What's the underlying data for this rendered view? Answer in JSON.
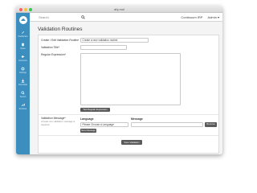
{
  "window": {
    "url_title": "ahj.mol"
  },
  "sidebar": {
    "items": [
      {
        "label": "Dashboard",
        "icon": "pencil-icon"
      },
      {
        "label": "Notes",
        "icon": "document-icon"
      },
      {
        "label": "Announce",
        "icon": "megaphone-icon"
      },
      {
        "label": "Settings",
        "icon": "gear-icon"
      },
      {
        "label": "Download",
        "icon": "download-icon"
      },
      {
        "label": "Search",
        "icon": "search-icon"
      },
      {
        "label": "Routines",
        "icon": "wrench-icon"
      }
    ]
  },
  "topbar": {
    "search_placeholder": "Search",
    "user_links": [
      "Continuum IRP",
      "Admin ▾"
    ]
  },
  "page": {
    "title": "Validation Routines"
  },
  "form": {
    "routine_label": "Create / Edit Validation Routine",
    "routine_select": "Create a new validation routine",
    "title_label": "Validation Title*",
    "title_value": "",
    "regex_label": "Regular Expression*",
    "regex_value": "",
    "test_button": "Test Regular Expression",
    "messages_label": "Validation Message*",
    "messages_hint": "At least one validation message is required.",
    "language_header": "Language",
    "message_header": "Message",
    "language_select": "Please Choose a Language",
    "message_value": "",
    "remove_button": "Remove",
    "new_message_button": "New Message",
    "save_button": "Save Validation"
  },
  "colors": {
    "sidebar": "#3b8ebe",
    "button": "#5a5a5a"
  }
}
